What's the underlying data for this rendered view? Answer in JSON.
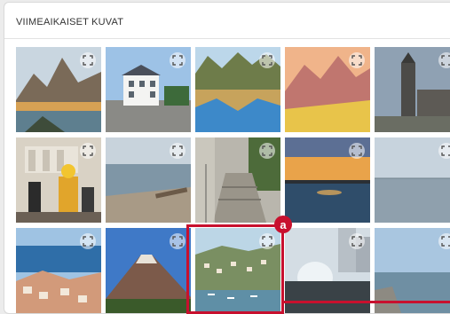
{
  "panel": {
    "title": "VIIMEAIKAISET KUVAT"
  },
  "annotation": {
    "marker_label": "a",
    "accent_color": "#c8102e"
  },
  "expand_icon": "expand-icon",
  "thumbnails": [
    {
      "subject": "mountain-lake"
    },
    {
      "subject": "white-house-street"
    },
    {
      "subject": "cliffs-water-reflection"
    },
    {
      "subject": "pink-mountains-sunset"
    },
    {
      "subject": "church-tower"
    },
    {
      "subject": "lego-figures"
    },
    {
      "subject": "lake-shore"
    },
    {
      "subject": "stone-stairs"
    },
    {
      "subject": "lake-sunset"
    },
    {
      "subject": "sea-horizon"
    },
    {
      "subject": "coastal-town"
    },
    {
      "subject": "volcano-mountain"
    },
    {
      "subject": "harbor-town"
    },
    {
      "subject": "fountain-city"
    },
    {
      "subject": "pier-sea"
    }
  ]
}
